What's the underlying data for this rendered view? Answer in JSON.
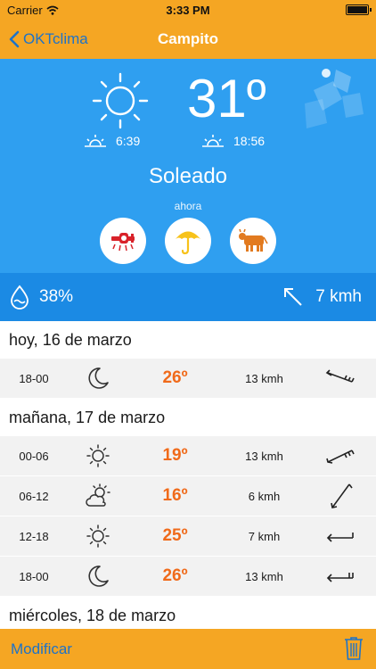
{
  "status": {
    "carrier": "Carrier",
    "time": "3:33 PM"
  },
  "nav": {
    "back_label": "OKTclima",
    "title": "Campito"
  },
  "current": {
    "temperature": "31º",
    "sunrise": "6:39",
    "sunset": "18:56",
    "condition": "Soleado",
    "time_label": "ahora",
    "humidity": "38%",
    "wind": "7 kmh",
    "activity_icons": [
      "airplane-icon",
      "umbrella-icon",
      "cow-icon"
    ]
  },
  "forecast": {
    "days": [
      {
        "label": "hoy, 16 de marzo",
        "rows": [
          {
            "period": "18-00",
            "icon": "moon-icon",
            "temp": "26º",
            "wind": "13 kmh",
            "direction": "arrow-icon"
          }
        ]
      },
      {
        "label": "mañana, 17 de marzo",
        "rows": [
          {
            "period": "00-06",
            "icon": "sun-icon",
            "temp": "19º",
            "wind": "13 kmh",
            "direction": "arrow-icon"
          },
          {
            "period": "06-12",
            "icon": "partly-cloudy-icon",
            "temp": "16º",
            "wind": "6 kmh",
            "direction": "arrow-icon"
          },
          {
            "period": "12-18",
            "icon": "sun-icon",
            "temp": "25º",
            "wind": "7 kmh",
            "direction": "arrow-icon"
          },
          {
            "period": "18-00",
            "icon": "moon-icon",
            "temp": "26º",
            "wind": "13 kmh",
            "direction": "arrow-icon"
          }
        ]
      },
      {
        "label": "miércoles, 18 de marzo",
        "rows": []
      }
    ]
  },
  "toolbar": {
    "edit_label": "Modificar"
  },
  "colors": {
    "accent": "#f5a623",
    "sky": "#2f9ff0",
    "sky_dark": "#1b8ae4",
    "temp": "#f06a1a",
    "link": "#1e73c8"
  }
}
